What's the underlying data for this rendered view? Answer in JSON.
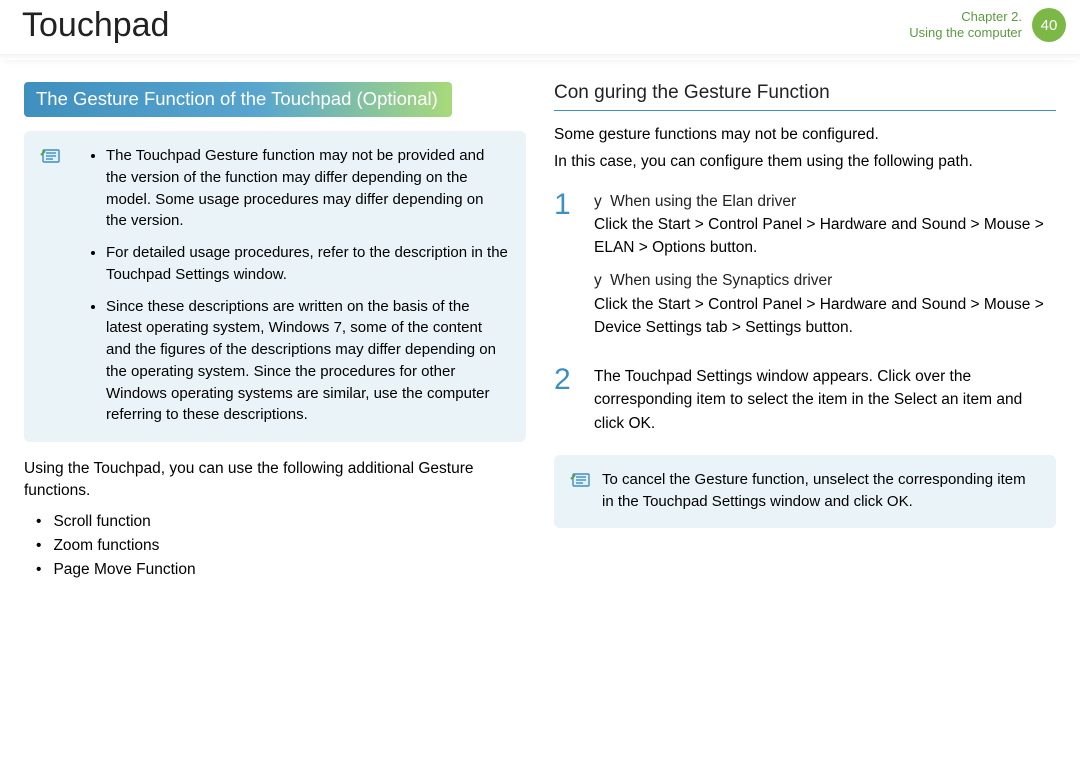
{
  "header": {
    "title": "Touchpad",
    "chapter_line1": "Chapter 2.",
    "chapter_line2": "Using the computer",
    "page_number": "40"
  },
  "left": {
    "banner": "The Gesture Function of the Touchpad (Optional)",
    "note_items": [
      "The Touchpad Gesture function may not be provided and the version of the function may differ depending on the model. Some usage procedures may differ depending on the version.",
      "For detailed usage procedures, refer to the description in the Touchpad Settings window.",
      "Since these descriptions are written on the basis of the latest operating system, Windows 7, some of the content and the figures of the descriptions may differ depending on the operating system. Since the procedures for other Windows operating systems are similar, use the computer referring to these descriptions."
    ],
    "intro": "Using the Touchpad, you can use the following additional Gesture functions.",
    "functions": [
      "Scroll function",
      "Zoom functions",
      "Page Move Function"
    ]
  },
  "right": {
    "subheading": "Con guring the Gesture Function",
    "intro1": "Some gesture functions may not be configured.",
    "intro2": "In this case, you can configure them using the following path.",
    "step1": {
      "num": "1",
      "elan_lead": "When using the Elan driver",
      "elan_body": "Click the Start > Control Panel > Hardware and Sound > Mouse > ELAN > Options button.",
      "syn_lead": "When using the Synaptics driver",
      "syn_body": "Click the Start > Control Panel > Hardware and Sound > Mouse > Device Settings tab > Settings button."
    },
    "step2": {
      "num": "2",
      "body": "The Touchpad Settings window appears. Click over the corresponding item to select the item in the Select an item and click OK."
    },
    "cancel_note": "To cancel the Gesture function, unselect the corresponding item in the Touchpad Settings window and click OK."
  }
}
